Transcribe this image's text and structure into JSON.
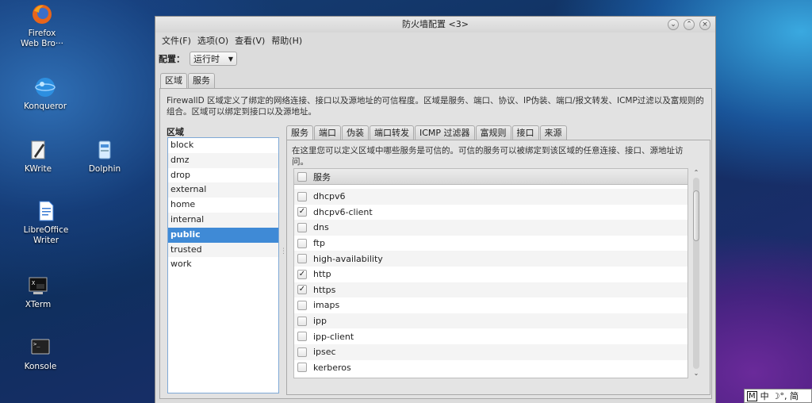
{
  "desktop": {
    "icons": [
      {
        "label1": "Firefox",
        "label2": "Web Bro···"
      },
      {
        "label1": "Konqueror",
        "label2": ""
      },
      {
        "label1": "KWrite",
        "label2": ""
      },
      {
        "label1": "Dolphin",
        "label2": ""
      },
      {
        "label1": "LibreOffice",
        "label2": "Writer"
      },
      {
        "label1": "XTerm",
        "label2": ""
      },
      {
        "label1": "Konsole",
        "label2": ""
      }
    ]
  },
  "window": {
    "title": "防火墙配置 <3>",
    "menu": [
      "文件(F)",
      "选项(O)",
      "查看(V)",
      "帮助(H)"
    ],
    "config_label": "配置：",
    "config_value": "运行时",
    "main_tabs": [
      "区域",
      "服务"
    ],
    "zone_description": "FirewallD 区域定义了绑定的网络连接、接口以及源地址的可信程度。区域是服务、端口、协议、IP伪装、端口/报文转发、ICMP过滤以及富规则的组合。区域可以绑定到接口以及源地址。",
    "zone_heading": "区域",
    "zones": [
      "block",
      "dmz",
      "drop",
      "external",
      "home",
      "internal",
      "public",
      "trusted",
      "work"
    ],
    "selected_zone": "public",
    "sub_tabs": [
      "服务",
      "端口",
      "伪装",
      "端口转发",
      "ICMP 过滤器",
      "富规则",
      "接口",
      "来源"
    ],
    "services_description": "在这里您可以定义区域中哪些服务是可信的。可信的服务可以被绑定到该区域的任意连接、接口、源地址访问。",
    "services_column": "服务",
    "services": [
      {
        "name": "dhcpv6",
        "checked": false
      },
      {
        "name": "dhcpv6-client",
        "checked": true
      },
      {
        "name": "dns",
        "checked": false
      },
      {
        "name": "ftp",
        "checked": false
      },
      {
        "name": "high-availability",
        "checked": false
      },
      {
        "name": "http",
        "checked": true
      },
      {
        "name": "https",
        "checked": true
      },
      {
        "name": "imaps",
        "checked": false
      },
      {
        "name": "ipp",
        "checked": false
      },
      {
        "name": "ipp-client",
        "checked": false
      },
      {
        "name": "ipsec",
        "checked": false
      },
      {
        "name": "kerberos",
        "checked": false
      }
    ]
  },
  "tray": {
    "ime_mode": "M",
    "ime_lang": "中",
    "ime_rest": "☽°, 简"
  }
}
